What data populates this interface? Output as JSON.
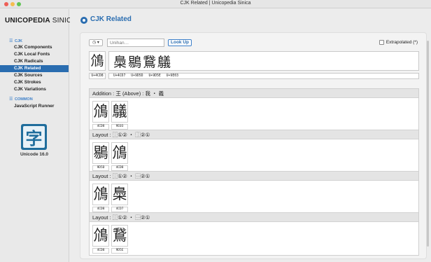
{
  "window": {
    "title": "CJK Related | Unicopedia Sinica"
  },
  "sidebar": {
    "brand_bold": "UNICOPEDIA",
    "brand_rest": " SINICA",
    "sections": [
      {
        "label": "CJK",
        "items": [
          "CJK Components",
          "CJK Local Fonts",
          "CJK Radicals",
          "CJK Related",
          "CJK Sources",
          "CJK Strokes",
          "CJK Variations"
        ]
      },
      {
        "label": "COMMON",
        "items": [
          "JavaScript Runner"
        ]
      }
    ],
    "selected": "CJK Related",
    "logo_glyph": "字",
    "unicode_version": "Unicode 16.0"
  },
  "header": {
    "title": "CJK Related"
  },
  "toolbar": {
    "history_label": "◷ ▾",
    "search_placeholder": "Unihan…",
    "search_value": "",
    "lookup_label": "Look Up",
    "extrapolated_label": "Extrapolated (*)",
    "extrapolated_checked": false
  },
  "character": {
    "glyph": "䲸",
    "code": "U+4CD8",
    "related": [
      {
        "glyph": "䲷",
        "code": "U+4CD7"
      },
      {
        "glyph": "鶍",
        "code": "U+9D5D"
      },
      {
        "glyph": "鵞",
        "code": "U+9D5E"
      },
      {
        "glyph": "鸃",
        "code": "U+9E03"
      }
    ]
  },
  "sections": [
    {
      "header": "Addition : 王 (Above) : 我 ・ 義",
      "glyphs": [
        {
          "glyph": "䲸",
          "code": "4CD8"
        },
        {
          "glyph": "鸃",
          "code": "9E03"
        }
      ]
    },
    {
      "header": "Layout : ⿰①② ・ ⿰②①",
      "glyphs": [
        {
          "glyph": "鶍",
          "code": "9D5D"
        },
        {
          "glyph": "䲸",
          "code": "4CD8"
        }
      ]
    },
    {
      "header": "Layout : ⿰①② ・ ⿱②①",
      "glyphs": [
        {
          "glyph": "䲸",
          "code": "4CD8"
        },
        {
          "glyph": "䲷",
          "code": "4CD7"
        }
      ]
    },
    {
      "header": "Layout : ⿰①② ・ ⿱②①",
      "glyphs": [
        {
          "glyph": "䲸",
          "code": "4CD8"
        },
        {
          "glyph": "鵞",
          "code": "9D5E"
        }
      ]
    }
  ]
}
